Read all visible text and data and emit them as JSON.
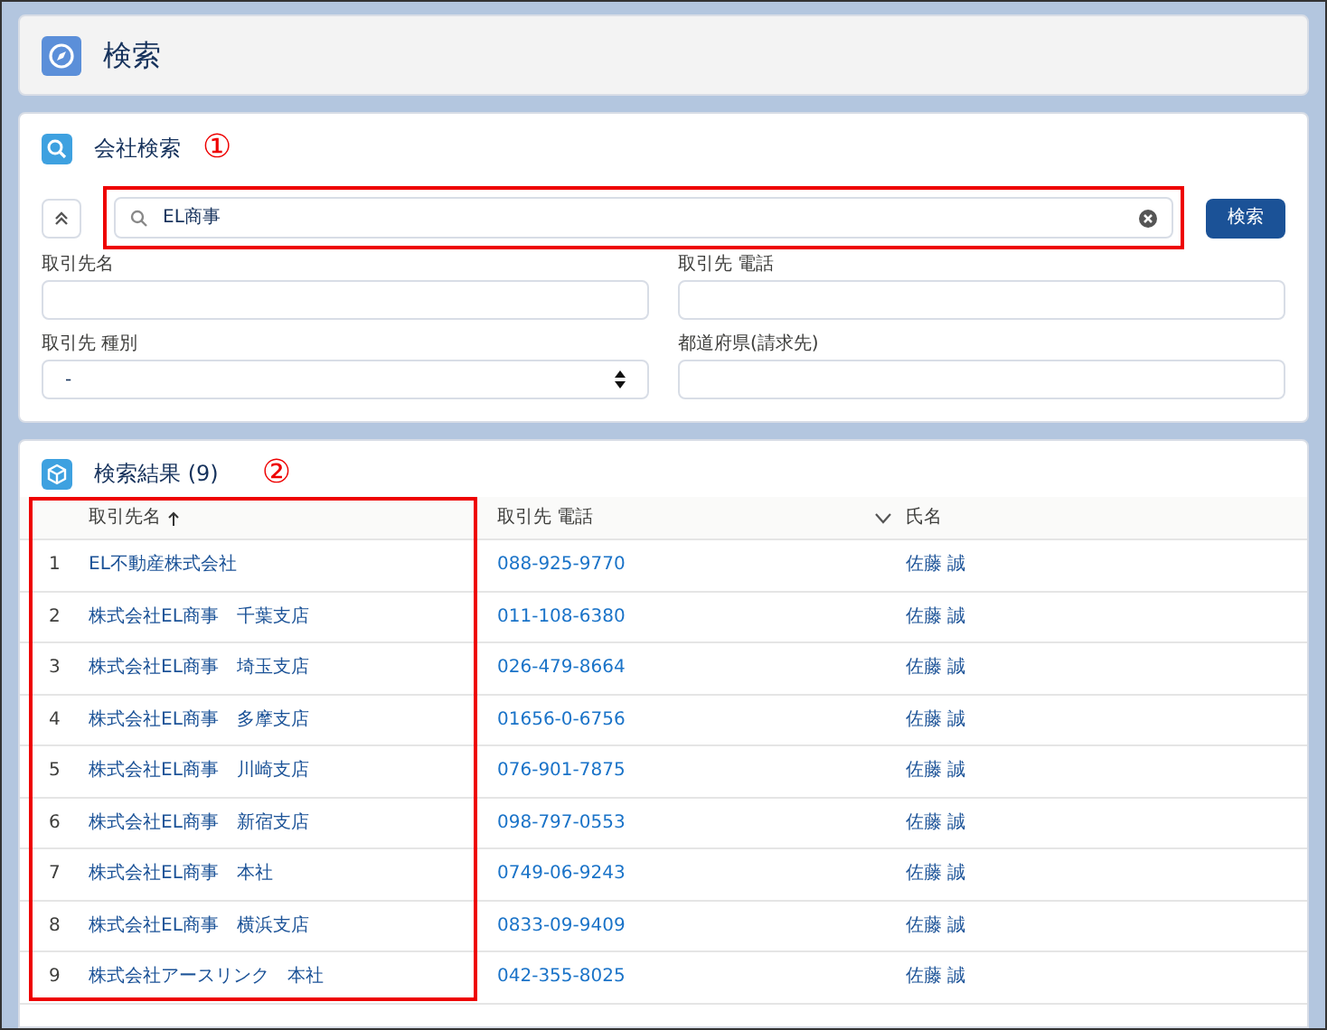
{
  "header": {
    "title": "検索"
  },
  "company_search": {
    "title": "会社検索",
    "annotation": "①",
    "search": {
      "value": "EL商事"
    },
    "search_button": "検索",
    "fields": [
      {
        "label": "取引先名",
        "kind": "text"
      },
      {
        "label": "取引先 電話",
        "kind": "text"
      },
      {
        "label": "取引先 種別",
        "kind": "select",
        "value": "-"
      },
      {
        "label": "都道府県(請求先)",
        "kind": "text"
      }
    ]
  },
  "results": {
    "title": "検索結果 (9)",
    "annotation": "②",
    "columns": [
      {
        "label": "取引先名",
        "sorted": true,
        "menu": false
      },
      {
        "label": "取引先 電話",
        "sorted": false,
        "menu": true
      },
      {
        "label": "氏名",
        "sorted": false,
        "menu": false
      }
    ],
    "rows": [
      {
        "number": "1",
        "name": "EL不動産株式会社",
        "phone": "088-925-9770",
        "contact": "佐藤 誠"
      },
      {
        "number": "2",
        "name": "株式会社EL商事　千葉支店",
        "phone": "011-108-6380",
        "contact": "佐藤 誠"
      },
      {
        "number": "3",
        "name": "株式会社EL商事　埼玉支店",
        "phone": "026-479-8664",
        "contact": "佐藤 誠"
      },
      {
        "number": "4",
        "name": "株式会社EL商事　多摩支店",
        "phone": "01656-0-6756",
        "contact": "佐藤 誠"
      },
      {
        "number": "5",
        "name": "株式会社EL商事　川崎支店",
        "phone": "076-901-7875",
        "contact": "佐藤 誠"
      },
      {
        "number": "6",
        "name": "株式会社EL商事　新宿支店",
        "phone": "098-797-0553",
        "contact": "佐藤 誠"
      },
      {
        "number": "7",
        "name": "株式会社EL商事　本社",
        "phone": "0749-06-9243",
        "contact": "佐藤 誠"
      },
      {
        "number": "8",
        "name": "株式会社EL商事　横浜支店",
        "phone": "0833-09-9409",
        "contact": "佐藤 誠"
      },
      {
        "number": "9",
        "name": "株式会社アースリンク　本社",
        "phone": "042-355-8025",
        "contact": "佐藤 誠"
      }
    ]
  }
}
